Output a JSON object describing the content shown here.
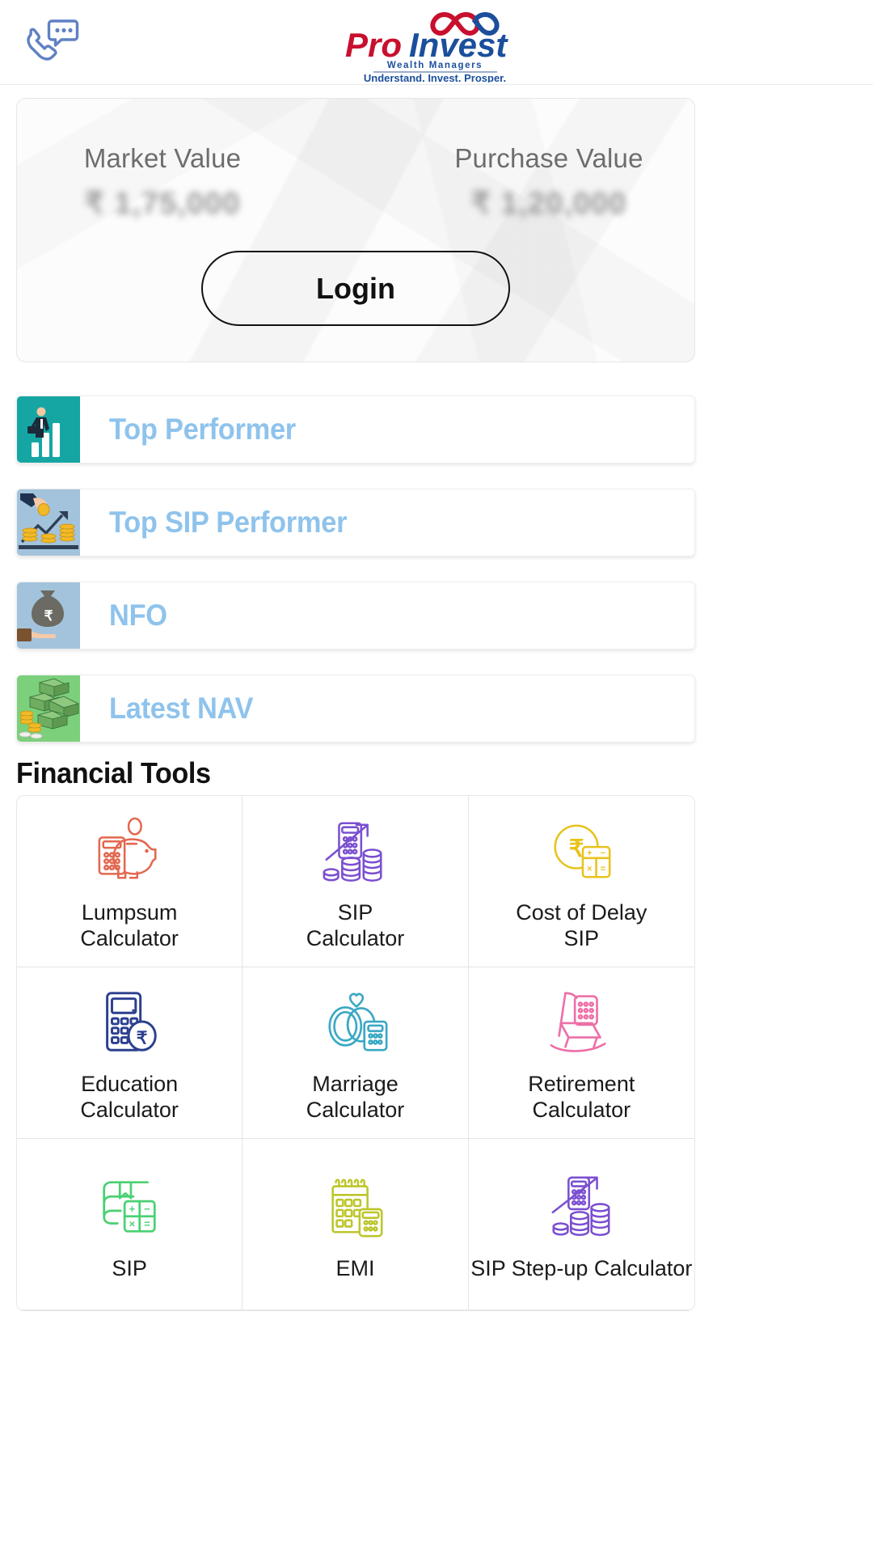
{
  "header": {
    "call_icon": "phone-chat-icon",
    "logo": {
      "brand_pro": "Pro",
      "brand_invest": "Invest",
      "subtitle": "Wealth Managers",
      "tagline": "Understand. Invest. Prosper.",
      "color_red": "#c8102e",
      "color_blue": "#1b4f9c"
    }
  },
  "portfolio": {
    "market_label": "Market Value",
    "market_value": "₹ 1,75,000",
    "purchase_label": "Purchase Value",
    "purchase_value": "₹ 1,20,000",
    "login_label": "Login"
  },
  "nav_cards": [
    {
      "label": "Top Performer",
      "icon": "businessman-growth-icon",
      "bg": "#15a6a4"
    },
    {
      "label": "Top SIP Performer",
      "icon": "hand-coin-chart-icon",
      "bg": "#a3c3dc"
    },
    {
      "label": "NFO",
      "icon": "money-bag-hand-icon",
      "bg": "#a3c3dc"
    },
    {
      "label": "Latest NAV",
      "icon": "cash-stacks-icon",
      "bg": "#7cd07c"
    }
  ],
  "tools_section": {
    "title": "Financial Tools",
    "tools": [
      {
        "label_line1": "Lumpsum",
        "label_line2": "Calculator",
        "icon": "piggy-bank-calculator-icon",
        "color": "#e2684f"
      },
      {
        "label_line1": "SIP",
        "label_line2": "Calculator",
        "icon": "sip-coins-calculator-icon",
        "color": "#7b4fd0"
      },
      {
        "label_line1": "Cost of Delay",
        "label_line2": "SIP",
        "icon": "rupee-coin-calculator-icon",
        "color": "#e8c31d"
      },
      {
        "label_line1": "Education",
        "label_line2": "Calculator",
        "icon": "education-calculator-icon",
        "color": "#2b3f8f"
      },
      {
        "label_line1": "Marriage",
        "label_line2": "Calculator",
        "icon": "wedding-rings-calculator-icon",
        "color": "#3aa8c4"
      },
      {
        "label_line1": "Retirement",
        "label_line2": "Calculator",
        "icon": "rocking-chair-icon",
        "color": "#ee6fa8"
      },
      {
        "label_line1": "SIP",
        "label_line2": "",
        "icon": "book-calculator-icon",
        "color": "#4ad173"
      },
      {
        "label_line1": "EMI",
        "label_line2": "",
        "icon": "emi-calendar-calculator-icon",
        "color": "#bcc62a"
      },
      {
        "label_line1": "SIP Step-up Calculator",
        "label_line2": "",
        "icon": "sip-stepup-icon",
        "color": "#7b4fd0"
      }
    ]
  }
}
